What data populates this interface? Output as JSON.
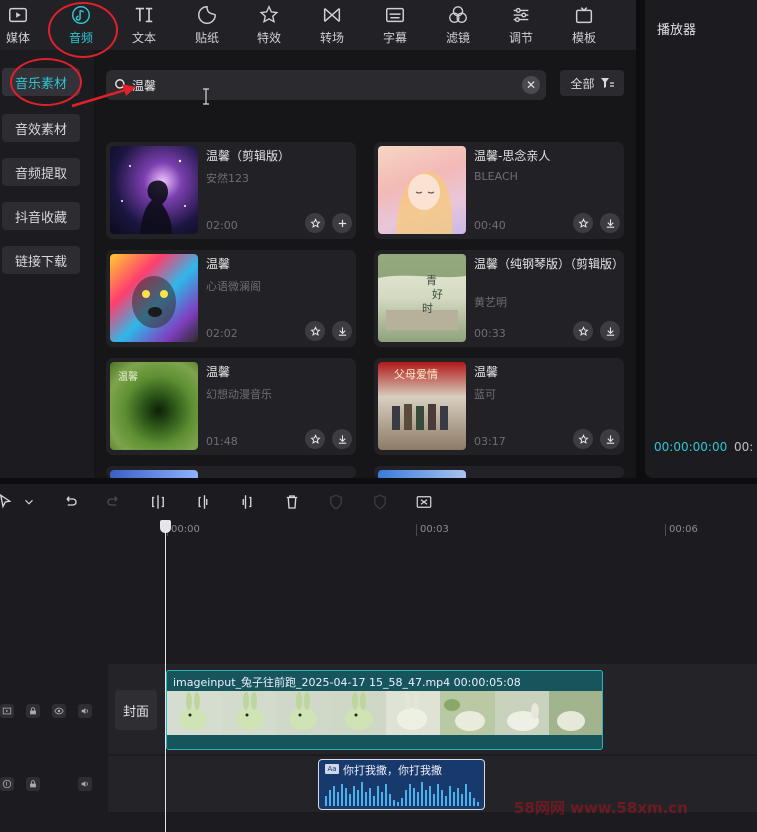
{
  "categories": [
    {
      "label": "媒体",
      "icon": "media-icon"
    },
    {
      "label": "音频",
      "icon": "audio-note-icon",
      "active": true
    },
    {
      "label": "文本",
      "icon": "text-icon"
    },
    {
      "label": "贴纸",
      "icon": "sticker-icon"
    },
    {
      "label": "特效",
      "icon": "effects-star-icon"
    },
    {
      "label": "转场",
      "icon": "transition-icon"
    },
    {
      "label": "字幕",
      "icon": "subtitle-icon"
    },
    {
      "label": "滤镜",
      "icon": "filter-icon"
    },
    {
      "label": "调节",
      "icon": "adjust-icon"
    },
    {
      "label": "模板",
      "icon": "template-icon"
    }
  ],
  "sidebar": {
    "items": [
      {
        "label": "音乐素材",
        "active": true
      },
      {
        "label": "音效素材"
      },
      {
        "label": "音频提取"
      },
      {
        "label": "抖音收藏"
      },
      {
        "label": "链接下载"
      }
    ]
  },
  "search": {
    "value": "温馨"
  },
  "filter": {
    "label": "全部"
  },
  "songs": [
    {
      "title": "温馨（剪辑版）",
      "artist": "安然123",
      "duration": "02:00",
      "action": "add"
    },
    {
      "title": "温馨-思念亲人",
      "artist": "BLEACH",
      "duration": "00:40",
      "action": "download"
    },
    {
      "title": "温馨",
      "artist": "心语微澜阁",
      "duration": "02:02",
      "action": "download"
    },
    {
      "title": "温馨（纯钢琴版）（剪辑版）",
      "artist": "黄艺明",
      "duration": "00:33",
      "action": "download"
    },
    {
      "title": "温馨",
      "artist": "幻想动漫音乐",
      "duration": "01:48",
      "action": "download"
    },
    {
      "title": "温馨",
      "artist": "蓝可",
      "duration": "03:17",
      "action": "download"
    }
  ],
  "player": {
    "title": "播放器",
    "time": "00:00:00:00",
    "time_total": "00:"
  },
  "timeline": {
    "ticks": [
      "00:00",
      "00:03",
      "00:06"
    ],
    "cover_label": "封面",
    "video_clip": "imageinput_兔子往前跑_2025-04-17 15_58_47.mp4  00:00:05:08",
    "audio_clip": "你打我撒，你打我撒",
    "audio_tag": "Aa"
  },
  "watermark": "58网网 www.58xm.cn",
  "colors": {
    "accent": "#2fc6d3",
    "annotation": "#e0202a",
    "video_clip": "#16555c",
    "audio_clip": "#17396b"
  }
}
